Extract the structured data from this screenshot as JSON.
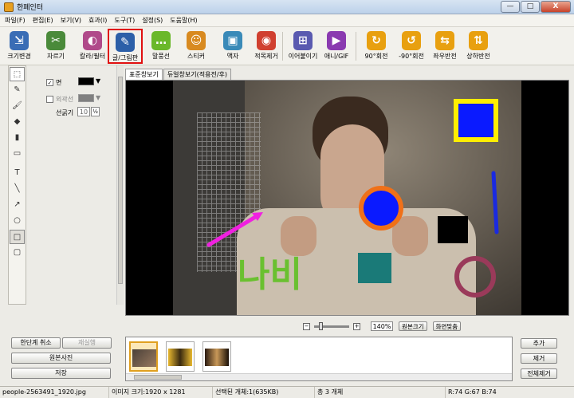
{
  "window": {
    "title": "한페인터",
    "minimize": "—",
    "maximize": "□",
    "close": "X"
  },
  "menu": [
    "파일(F)",
    "편집(E)",
    "보기(V)",
    "효과(I)",
    "도구(T)",
    "설정(S)",
    "도움말(H)"
  ],
  "toolbar": [
    {
      "label": "크기변경",
      "icon": "resize-icon",
      "color": "#3a6db5",
      "glyph": "⇲"
    },
    {
      "label": "자르기",
      "icon": "crop-icon",
      "color": "#4a8a3a",
      "glyph": "✂"
    },
    {
      "label": "칼라/필터",
      "icon": "color-filter-icon",
      "color": "#b04a8a",
      "glyph": "◐"
    },
    {
      "label": "글/그림판",
      "icon": "text-draw-icon",
      "color": "#2c5fa8",
      "glyph": "✎",
      "selected": true
    },
    {
      "label": "말풍선",
      "icon": "speech-bubble-icon",
      "color": "#6ab82a",
      "glyph": "…"
    },
    {
      "label": "스티커",
      "icon": "sticker-icon",
      "color": "#d88a20",
      "glyph": "☺"
    },
    {
      "label": "액자",
      "icon": "frame-icon",
      "color": "#3a8ab8",
      "glyph": "▣"
    },
    {
      "label": "적목제거",
      "icon": "redeye-icon",
      "color": "#d04030",
      "glyph": "◉"
    },
    {
      "label": "이어붙이기",
      "icon": "merge-icon",
      "color": "#5a5ab0",
      "glyph": "⊞"
    },
    {
      "label": "애니/GIF",
      "icon": "animation-gif-icon",
      "color": "#8a3ab0",
      "glyph": "▶"
    },
    {
      "label": "90°회전",
      "icon": "rotate-cw-icon",
      "color": "#e8a010",
      "glyph": "↻"
    },
    {
      "label": "-90°회전",
      "icon": "rotate-ccw-icon",
      "color": "#e8a010",
      "glyph": "↺"
    },
    {
      "label": "좌우반전",
      "icon": "flip-horizontal-icon",
      "color": "#e8a010",
      "glyph": "⇆"
    },
    {
      "label": "상하반전",
      "icon": "flip-vertical-icon",
      "color": "#e8a010",
      "glyph": "⇅"
    }
  ],
  "draw_tools": [
    {
      "name": "select-rect-icon",
      "glyph": "⬚"
    },
    {
      "name": "pen-icon",
      "glyph": "✎"
    },
    {
      "name": "brush-icon",
      "glyph": "🖌"
    },
    {
      "name": "fill-bucket-icon",
      "glyph": "◆"
    },
    {
      "name": "spray-icon",
      "glyph": "▮"
    },
    {
      "name": "eraser-icon",
      "glyph": "▭"
    },
    {
      "name": "text-tool-icon",
      "glyph": "T"
    },
    {
      "name": "line-tool-icon",
      "glyph": "╲"
    },
    {
      "name": "arrow-tool-icon",
      "glyph": "↗"
    },
    {
      "name": "ellipse-tool-icon",
      "glyph": "○"
    },
    {
      "name": "rectangle-tool-icon",
      "glyph": "□"
    },
    {
      "name": "rounded-rect-tool-icon",
      "glyph": "▢"
    }
  ],
  "props": {
    "face_label": "면",
    "outline_label": "외곽선",
    "stroke_label": "선굵기",
    "stroke_value": "10",
    "face_color": "#000000",
    "outline_color": "#808080"
  },
  "tabs": [
    "표준창보기",
    "듀얼창보기(적용전/후)"
  ],
  "zoom": {
    "minus": "−",
    "plus": "+",
    "value": "140%",
    "original_label": "원본크기",
    "fit_label": "화면맞춤"
  },
  "left_buttons": {
    "undo": "한단계 취소",
    "redo": "재실행",
    "original": "원본사진",
    "save": "저장"
  },
  "right_buttons": {
    "add": "추가",
    "remove": "제거",
    "remove_all": "전체제거"
  },
  "canvas_text": "나비",
  "status": {
    "file": "people-2563491_1920.jpg",
    "size": "이미지 크기:1920 x 1281",
    "selected": "선택된 개체:1(635KB)",
    "total": "총 3 개체",
    "pixel": "R:74 G:67 B:74"
  }
}
